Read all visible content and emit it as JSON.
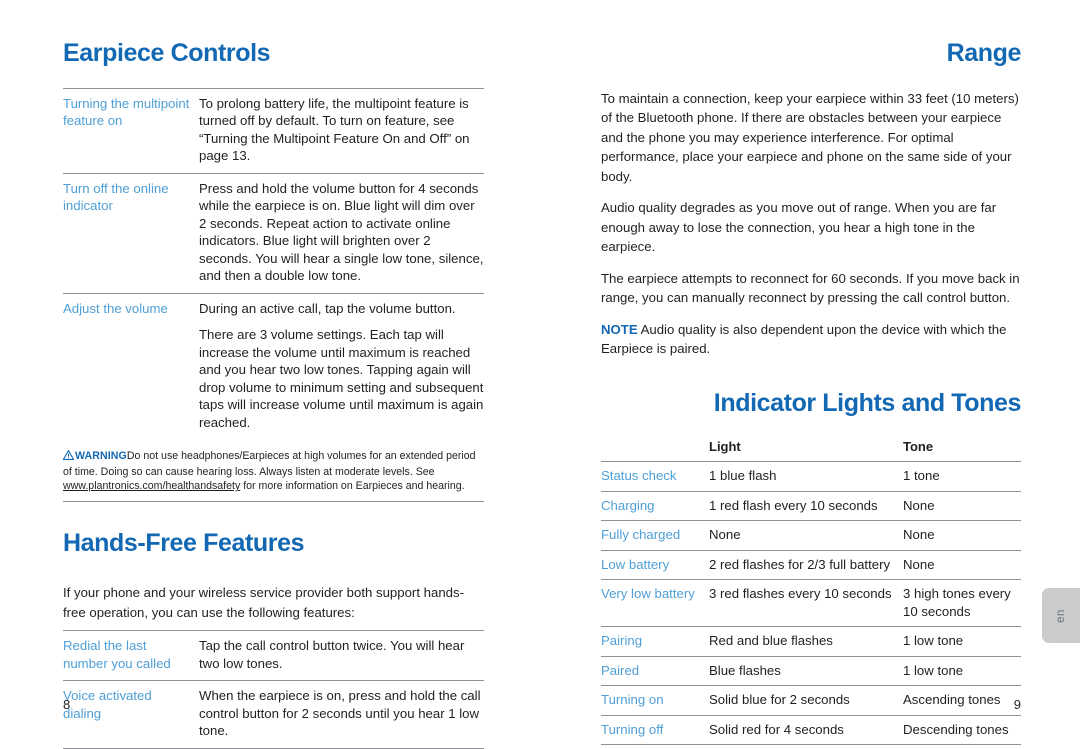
{
  "left_page": {
    "folio": "8",
    "earpiece_controls": {
      "title": "Earpiece Controls",
      "rows": [
        {
          "label": "Turning the multipoint feature on",
          "paragraphs": [
            "To prolong battery life, the multipoint feature is turned off by default. To turn on feature, see “Turning the Multipoint Feature On and Off” on page 13."
          ]
        },
        {
          "label": "Turn off the online indicator",
          "paragraphs": [
            "Press and hold the volume button for 4 seconds while the earpiece is on. Blue light will dim over 2 seconds. Repeat action to activate online indicators. Blue light will brighten over 2 seconds. You will hear a single low tone, silence, and then a double low tone."
          ]
        },
        {
          "label": "Adjust the volume",
          "paragraphs": [
            "During an active call, tap the volume button.",
            "There are 3 volume settings. Each tap will increase the volume until maximum is reached and you hear two low tones. Tapping again will drop volume to minimum setting and subsequent taps will increase volume until maximum is again reached."
          ]
        }
      ]
    },
    "warning": {
      "icon": "warning-triangle-icon",
      "word": "WARNING",
      "text_before_link": "Do not use headphones/Earpieces at high volumes for an extended period of time. Doing so can cause hearing loss. Always listen at moderate levels. See ",
      "link": "www.plantronics.com/healthandsafety",
      "text_after_link": " for more information on Earpieces and hearing."
    },
    "hands_free": {
      "title": "Hands-Free Features",
      "intro": "If your phone and your wireless service provider both support hands-free operation, you can use the following features:",
      "rows": [
        {
          "label": "Redial the last number you called",
          "paragraphs": [
            "Tap the call control button twice. You will hear two low tones."
          ]
        },
        {
          "label": "Voice activated dialing",
          "paragraphs": [
            "When the earpiece is on, press and hold the call control button for 2 seconds until you hear 1 low tone."
          ]
        }
      ]
    }
  },
  "right_page": {
    "folio": "9",
    "range": {
      "title": "Range",
      "paragraphs": [
        "To maintain a connection, keep your earpiece within 33 feet (10 meters) of the Bluetooth phone. If there are obstacles between your earpiece and the phone you may experience interference. For optimal performance, place your earpiece and phone on the same side of your body.",
        "Audio quality degrades as you move out of range. When you are far enough away to lose the connection, you hear a high tone in the earpiece.",
        "The earpiece attempts to reconnect for 60 seconds. If you move back in range, you can manually reconnect by pressing the call control button."
      ],
      "note": {
        "word": "NOTE",
        "text": " Audio quality is also dependent upon the device with which the Earpiece is paired."
      }
    },
    "indicator": {
      "title": "Indicator Lights and Tones",
      "columns": [
        "",
        "Light",
        "Tone"
      ],
      "rows": [
        {
          "state": "Status check",
          "light": "1 blue flash",
          "tone": "1 tone"
        },
        {
          "state": "Charging",
          "light": "1 red flash every 10 seconds",
          "tone": "None"
        },
        {
          "state": "Fully charged",
          "light": "None",
          "tone": "None"
        },
        {
          "state": "Low battery",
          "light": "2 red flashes for 2/3 full battery",
          "tone": "None"
        },
        {
          "state": "Very low battery",
          "light": "3 red flashes every 10 seconds",
          "tone": "3 high tones every 10 seconds"
        },
        {
          "state": "Pairing",
          "light": "Red and blue flashes",
          "tone": "1 low tone"
        },
        {
          "state": "Paired",
          "light": "Blue flashes",
          "tone": "1 low tone"
        },
        {
          "state": "Turning on",
          "light": "Solid blue for 2 seconds",
          "tone": "Ascending tones"
        },
        {
          "state": "Turning off",
          "light": "Solid red for 4 seconds",
          "tone": "Descending tones"
        }
      ]
    }
  },
  "language_tab": {
    "label": "en"
  },
  "colors": {
    "heading_blue": "#1268b3",
    "label_blue": "#4e9fd6",
    "rule_gray": "#8d9094",
    "body_black": "#231f20",
    "tab_gray": "#c9cbcd"
  }
}
